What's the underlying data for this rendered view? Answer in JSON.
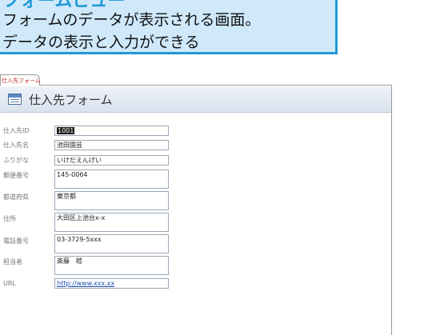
{
  "callout": {
    "title": "フォームビュー",
    "line1": "フォームのデータが表示される画面。",
    "line2": "データの表示と入力ができる"
  },
  "document_tab": {
    "label": "仕入先フォーム"
  },
  "form": {
    "title": "仕入先フォーム",
    "fields": [
      {
        "label": "仕入先ID",
        "value": "1001"
      },
      {
        "label": "仕入先名",
        "value": "池田園芸"
      },
      {
        "label": "ふりがな",
        "value": "いけだえんげい"
      },
      {
        "label": "郵便番号",
        "value": "145-0064"
      },
      {
        "label": "都道府県",
        "value": "東京都"
      },
      {
        "label": "住所",
        "value": "大田区上池台x-x"
      },
      {
        "label": "電話番号",
        "value": "03-3729-5xxx"
      },
      {
        "label": "担当者",
        "value": "斎藤　睦"
      },
      {
        "label": "URL",
        "value": "http://www.xxx.xx"
      }
    ]
  },
  "colors": {
    "callout_border": "#1f9ad6",
    "callout_fill": "#cfe9fb",
    "tab_text": "#c0392b",
    "link": "#1a4fb0"
  }
}
